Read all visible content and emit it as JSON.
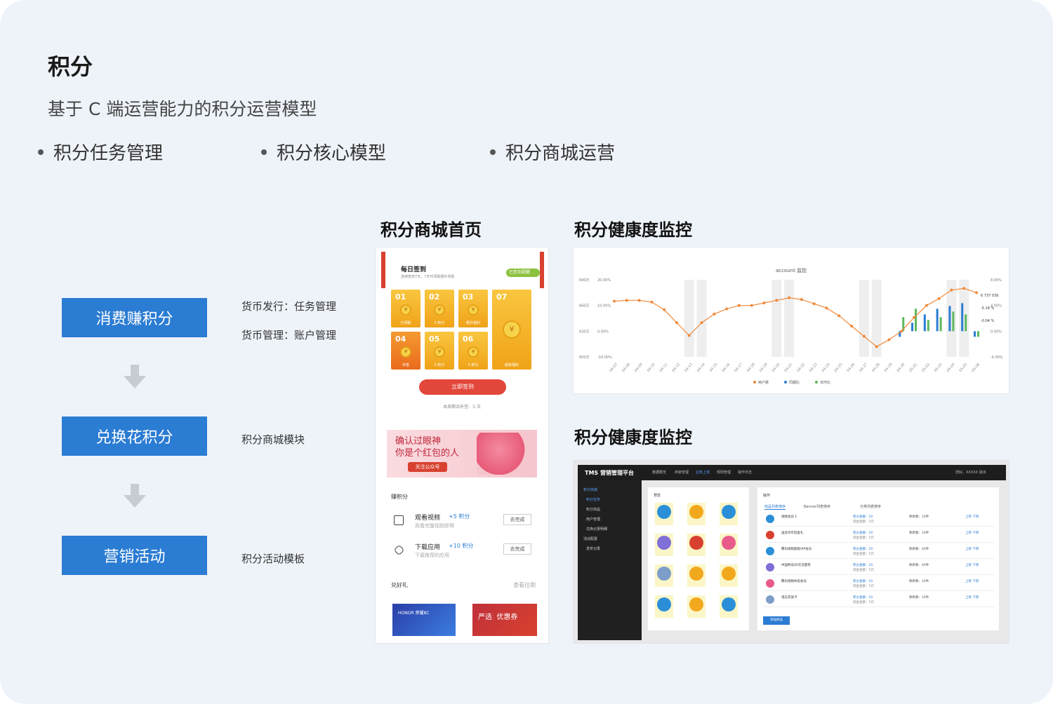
{
  "page": {
    "title": "积分",
    "subtitle": "基于 C 端运营能力的积分运营模型",
    "bullets": [
      "积分任务管理",
      "积分核心模型",
      "积分商城运营"
    ]
  },
  "flow": {
    "steps": [
      "消费赚积分",
      "兑换花积分",
      "营销活动"
    ],
    "labels": {
      "issue": "货币发行：任务管理",
      "manage": "货币管理：账户管理",
      "mall": "积分商城模块",
      "activity": "积分活动模板"
    }
  },
  "sections": {
    "mall_title": "积分商城首页",
    "monitor_title_1": "积分健康度监控",
    "monitor_title_2": "积分健康度监控"
  },
  "phone": {
    "header_title": "每日签到",
    "header_sub": "连续签到7天，7天可领取额外奖励",
    "header_badge": "已签到提醒",
    "tiles": [
      {
        "num": "01",
        "cap": "已领取"
      },
      {
        "num": "02",
        "cap": "5 积分"
      },
      {
        "num": "03",
        "cap": "额外福利"
      },
      {
        "num": "07",
        "cap": "超级福利"
      },
      {
        "num": "04",
        "cap": "补签"
      },
      {
        "num": "05",
        "cap": "5 积分"
      },
      {
        "num": "06",
        "cap": "5 积分"
      }
    ],
    "sign_button": "立即签到",
    "remain_text": "本周剩余补签：3 次",
    "banner_text": "确认过眼神\n你是个红包的人",
    "banner_tag": "关注公众号",
    "earn_title": "赚积分",
    "tasks": [
      {
        "title": "观看视频",
        "points": "+5 积分",
        "desc": "观看完整视频即得",
        "action": "去完成"
      },
      {
        "title": "下载应用",
        "points": "+10 积分",
        "desc": "下载推荐的应用",
        "action": "去完成"
      }
    ],
    "exchange_title": "兑好礼",
    "view_past": "查看往期",
    "gift1": "HONOR 荣耀8C",
    "gift2_a": "严选",
    "gift2_b": "优惠券"
  },
  "chart_data": {
    "type": "line",
    "title": "account 监控",
    "x": [
      "04-07",
      "04-08",
      "04-09",
      "04-10",
      "04-11",
      "04-12",
      "04-13",
      "04-14",
      "04-15",
      "04-16",
      "04-17",
      "04-18",
      "04-19",
      "04-20",
      "04-21",
      "04-22",
      "04-23",
      "04-24",
      "04-25",
      "04-26",
      "04-27",
      "04-28",
      "04-29",
      "04-30",
      "05-01",
      "05-02",
      "05-03",
      "05-04",
      "05-05",
      "05-06"
    ],
    "left_axis_labels": [
      "690万",
      "660万",
      "630万",
      "600万"
    ],
    "left_pct_labels": [
      "20.00%",
      "10.00%",
      "0.00%",
      "-10.00%"
    ],
    "right_axis_labels": [
      "8.00%",
      "4.00%",
      "0.00%",
      "-4.00%"
    ],
    "ylim": [
      600,
      690
    ],
    "series": [
      {
        "name": "用户数",
        "color": "#ef8a3c",
        "values": [
          665,
          666,
          666,
          664,
          655,
          640,
          625,
          640,
          650,
          656,
          660,
          660,
          663,
          666,
          669,
          667,
          662,
          657,
          648,
          636,
          624,
          612,
          620,
          630,
          646,
          660,
          668,
          678,
          680,
          675
        ]
      },
      {
        "name": "同期比",
        "color": "#2b7cd3",
        "values": [
          0,
          0,
          0,
          0,
          0,
          0,
          0,
          0,
          0,
          0,
          0,
          0,
          0,
          0,
          0,
          0,
          0,
          0,
          0,
          0,
          0,
          0,
          0,
          -1,
          1.5,
          3,
          4,
          4.5,
          5,
          -1
        ]
      },
      {
        "name": "日环比",
        "color": "#5cb85c",
        "values": [
          0,
          0,
          0,
          0,
          0,
          0,
          0,
          0,
          0,
          0,
          0,
          0,
          0,
          0,
          0,
          0,
          0,
          0,
          0,
          0,
          0,
          0,
          0,
          2.5,
          4,
          2,
          2.5,
          3.5,
          3,
          -1
        ]
      }
    ],
    "annotations": [
      "6 737 030",
      "-5.18 %",
      "-0.04 %"
    ],
    "colors": {
      "line": "#ef8a3c",
      "bar1": "#2b7cd3",
      "bar2": "#5cb85c"
    }
  },
  "admin": {
    "logo": "TMS 营销管理平台",
    "menu": [
      "数据概览",
      "商家管理",
      "业务上线",
      "规则管理",
      "操作日志"
    ],
    "active_menu_index": 2,
    "user": "您好，XXXXX   退出",
    "side": [
      "积分商城",
      "积分任务",
      "积分商品",
      "用户管理",
      "兑换记录明细",
      "活动配置",
      "发奖记录"
    ],
    "left_title": "预览",
    "right_title": "操作",
    "tabs": [
      "商品列表排序",
      "Banner列表排序",
      "分类列表排序"
    ],
    "rows": [
      {
        "name": "视频会员 1",
        "p1": "积分金额：10",
        "p2": "现金金额：5元",
        "r": "剩余数：10件",
        "a": "上移  下移",
        "color": "#2b8fd8"
      },
      {
        "name": "送虎牙年轻金礼",
        "p1": "积分金额：10",
        "p2": "现金金额：5元",
        "r": "剩余数：10件",
        "a": "上移  下移",
        "color": "#d8412f"
      },
      {
        "name": "腾讯视频超级VIP会员",
        "p1": "积分金额：10",
        "p2": "现金金额：5元",
        "r": "剩余数：40件",
        "a": "上移  下移",
        "color": "#2b8fd8"
      },
      {
        "name": "中国移动30元流量券",
        "p1": "积分金额：10",
        "p2": "现金金额：5元",
        "r": "剩余数：40件",
        "a": "上移  下移",
        "color": "#7f6fd6"
      },
      {
        "name": "腾讯视频体验会员",
        "p1": "积分金额：10",
        "p2": "现金金额：5元",
        "r": "剩余数：10件",
        "a": "上移  下移",
        "color": "#e85a8a"
      },
      {
        "name": "电信充值卡",
        "p1": "积分金额：10",
        "p2": "现金金额：5元",
        "r": "剩余数：10件",
        "a": "上移  下移",
        "color": "#7d9ec8"
      }
    ],
    "add_button": "添加商品"
  }
}
